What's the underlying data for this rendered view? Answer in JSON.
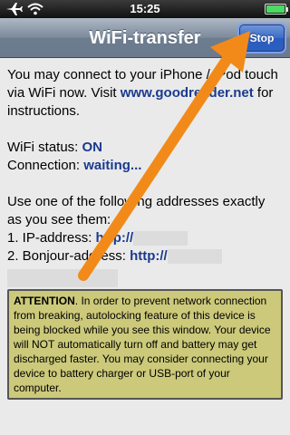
{
  "status_bar": {
    "time": "15:25"
  },
  "nav": {
    "title": "WiFi-transfer",
    "stop_label": "Stop"
  },
  "content": {
    "intro_line1": "You may connect to your iPhone / iPod touch",
    "intro_line2_prefix": "via WiFi now. Visit ",
    "intro_link": "www.goodreader.net",
    "intro_line2_suffix": " for",
    "intro_line3": "instructions.",
    "wifi_status_label": "WiFi status: ",
    "wifi_status_value": "ON",
    "connection_label": "Connection: ",
    "connection_value": "waiting...",
    "addresses_line1": "Use one of the following addresses exactly",
    "addresses_line2": "as you see them:",
    "ip_label": "1. IP-address: ",
    "ip_value": "http://",
    "bonjour_label": "2. Bonjour-address: ",
    "bonjour_value": "http://"
  },
  "attention": {
    "heading": "ATTENTION",
    "text": ". In order to prevent network connection from breaking, autolocking feature of this device is being blocked while you see this window. Your device will NOT automatically turn off and battery may get discharged faster. You may consider connecting your device to battery charger or USB-port of your computer."
  },
  "colors": {
    "accent_arrow": "#f28a1a",
    "link": "#1a3a8c",
    "nav_button": "#3a6bc8",
    "attention_bg": "#ccc97a"
  }
}
